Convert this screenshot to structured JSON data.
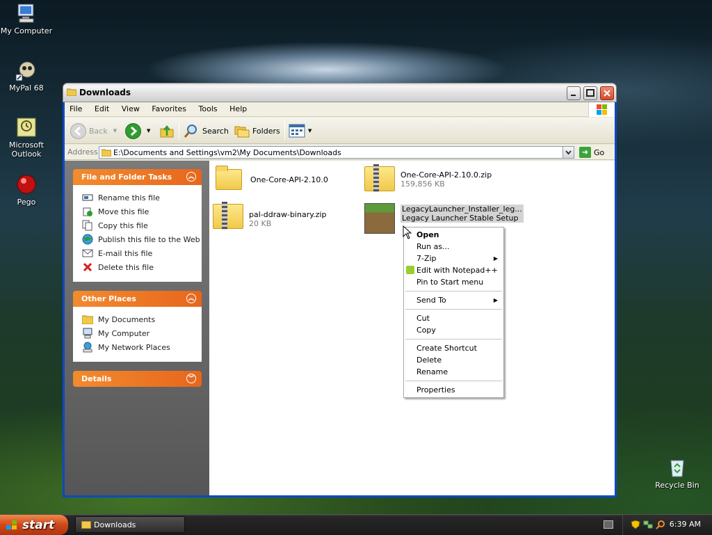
{
  "desktop": {
    "icons": [
      {
        "label": "My Computer"
      },
      {
        "label": "MyPal 68"
      },
      {
        "label": "Microsoft Outlook"
      },
      {
        "label": "Pego"
      },
      {
        "label": "Recycle Bin"
      }
    ]
  },
  "window": {
    "title": "Downloads",
    "menu": [
      "File",
      "Edit",
      "View",
      "Favorites",
      "Tools",
      "Help"
    ],
    "toolbar": {
      "back": "Back",
      "search": "Search",
      "folders": "Folders"
    },
    "address": {
      "label": "Address",
      "value": "E:\\Documents and Settings\\vm2\\My Documents\\Downloads",
      "go": "Go"
    }
  },
  "taskpane": {
    "file_tasks": {
      "title": "File and Folder Tasks",
      "items": [
        "Rename this file",
        "Move this file",
        "Copy this file",
        "Publish this file to the Web",
        "E-mail this file",
        "Delete this file"
      ]
    },
    "other_places": {
      "title": "Other Places",
      "items": [
        "My Documents",
        "My Computer",
        "My Network Places"
      ]
    },
    "details": {
      "title": "Details"
    }
  },
  "files": [
    {
      "name": "One-Core-API-2.10.0",
      "sub": ""
    },
    {
      "name": "One-Core-API-2.10.0.zip",
      "sub": "159,856 KB"
    },
    {
      "name": "pal-ddraw-binary.zip",
      "sub": "20 KB"
    },
    {
      "name": "LegacyLauncher_Installer_leg...",
      "sub": "Legacy Launcher Stable Setup"
    }
  ],
  "context_menu": {
    "items": [
      "Open",
      "Run as...",
      "7-Zip",
      "Edit with Notepad++",
      "Pin to Start menu",
      "Send To",
      "Cut",
      "Copy",
      "Create Shortcut",
      "Delete",
      "Rename",
      "Properties"
    ]
  },
  "taskbar": {
    "start": "start",
    "task": "Downloads",
    "time": "6:39 AM"
  },
  "colors": {
    "accent_orange": "#e7661c",
    "xp_blue": "#0a49c9"
  }
}
